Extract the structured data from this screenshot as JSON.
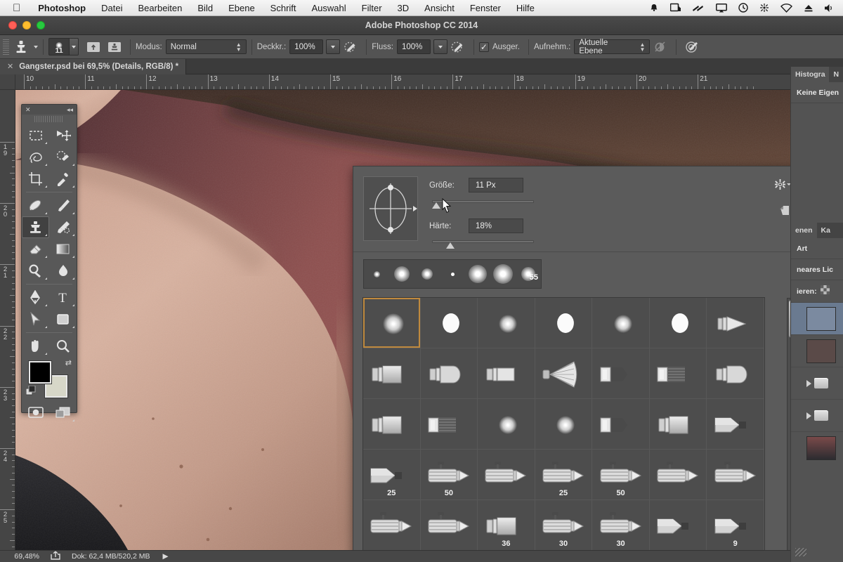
{
  "menubar": {
    "apple_icon": "apple-icon",
    "items": [
      {
        "label": "Photoshop",
        "bold": true
      },
      {
        "label": "Datei",
        "bold": false
      },
      {
        "label": "Bearbeiten",
        "bold": false
      },
      {
        "label": "Bild",
        "bold": false
      },
      {
        "label": "Ebene",
        "bold": false
      },
      {
        "label": "Schrift",
        "bold": false
      },
      {
        "label": "Auswahl",
        "bold": false
      },
      {
        "label": "Filter",
        "bold": false
      },
      {
        "label": "3D",
        "bold": false
      },
      {
        "label": "Ansicht",
        "bold": false
      },
      {
        "label": "Fenster",
        "bold": false
      },
      {
        "label": "Hilfe",
        "bold": false
      }
    ],
    "status_icons": [
      "bell-icon",
      "screen-share-icon",
      "fast-forward-icon",
      "airplay-icon",
      "time-machine-icon",
      "dropbox-icon",
      "wifi-icon",
      "eject-icon",
      "volume-icon"
    ]
  },
  "window": {
    "title": "Adobe Photoshop CC 2014",
    "close_label": "close-button",
    "minimize_label": "minimize-button",
    "zoom_label": "maximize-button"
  },
  "options_bar": {
    "tool_icon": "clone-stamp-icon",
    "brush_size": "11",
    "toggle_brush_panel_icon": "brush-panel-icon",
    "toggle_clone_source_icon": "clone-source-icon",
    "mode_label": "Modus:",
    "mode_value": "Normal",
    "opacity_label": "Deckkr.:",
    "opacity_value": "100%",
    "opacity_pressure_icon": "pressure-opacity-icon",
    "flow_label": "Fluss:",
    "flow_value": "100%",
    "airbrush_icon": "airbrush-icon",
    "aligned_label": "Ausger.",
    "aligned_checked": true,
    "sample_label": "Aufnehm.:",
    "sample_value": "Aktuelle Ebene",
    "ignore_adjustment_icon": "ignore-adjustment-layers-icon",
    "tablet_pressure_icon": "tablet-pressure-size-icon"
  },
  "document_tab": {
    "close_icon": "close-tab-icon",
    "title": "Gangster.psd bei 69,5% (Details, RGB/8) *"
  },
  "rulers": {
    "horizontal_labels": [
      "10",
      "11",
      "12",
      "13",
      "14",
      "15",
      "16",
      "17",
      "18",
      "19",
      "20",
      "21"
    ],
    "vertical_labels": [
      "19",
      "20",
      "21",
      "22",
      "23",
      "24",
      "25"
    ],
    "unit": "cm"
  },
  "toolbar": {
    "close_icon": "close-icon",
    "collapse_icon": "collapse-panel-icon",
    "tools": [
      {
        "name": "rectangular-marquee-tool",
        "sel": false,
        "tri": true
      },
      {
        "name": "move-tool",
        "sel": false,
        "tri": false
      },
      {
        "name": "lasso-tool",
        "sel": false,
        "tri": true
      },
      {
        "name": "quick-selection-tool",
        "sel": false,
        "tri": true
      },
      {
        "name": "crop-tool",
        "sel": false,
        "tri": true
      },
      {
        "name": "eyedropper-tool",
        "sel": false,
        "tri": true
      },
      {
        "name": "spot-healing-brush-tool",
        "sel": false,
        "tri": true
      },
      {
        "name": "brush-tool",
        "sel": false,
        "tri": true
      },
      {
        "name": "clone-stamp-tool",
        "sel": true,
        "tri": true
      },
      {
        "name": "history-brush-tool",
        "sel": false,
        "tri": true
      },
      {
        "name": "eraser-tool",
        "sel": false,
        "tri": true
      },
      {
        "name": "gradient-tool",
        "sel": false,
        "tri": true
      },
      {
        "name": "dodge-tool",
        "sel": false,
        "tri": true
      },
      {
        "name": "blur-tool",
        "sel": false,
        "tri": true
      },
      {
        "name": "pen-tool",
        "sel": false,
        "tri": true
      },
      {
        "name": "type-tool",
        "sel": false,
        "tri": true
      },
      {
        "name": "path-selection-tool",
        "sel": false,
        "tri": true
      },
      {
        "name": "rectangle-tool",
        "sel": false,
        "tri": true
      },
      {
        "name": "hand-tool",
        "sel": false,
        "tri": true
      },
      {
        "name": "zoom-tool",
        "sel": false,
        "tri": false
      }
    ],
    "foreground_color": "#000000",
    "background_color": "#d7d7c8",
    "swap_icon": "swap-colors-icon",
    "default_colors_icon": "default-colors-icon",
    "quick_mask_icon": "quick-mask-icon",
    "screen_mode_icon": "screen-mode-icon"
  },
  "brush_panel": {
    "size_label": "Größe:",
    "size_value": "11 Px",
    "size_slider_pct": 4,
    "hardness_label": "Härte:",
    "hardness_value": "18%",
    "hardness_slider_pct": 18,
    "gear_icon": "panel-options-gear-icon",
    "new_brush_icon": "new-brush-preset-icon",
    "tip_shape_icon": "brush-tip-angle-control",
    "recent_strip": [
      {
        "size": 9,
        "hard": false,
        "num": ""
      },
      {
        "size": 22,
        "hard": false,
        "num": ""
      },
      {
        "size": 16,
        "hard": false,
        "num": ""
      },
      {
        "size": 5,
        "hard": true,
        "num": ""
      },
      {
        "size": 26,
        "hard": false,
        "num": ""
      },
      {
        "size": 28,
        "hard": false,
        "num": ""
      },
      {
        "size": 20,
        "hard": false,
        "num": "55"
      }
    ],
    "presets": [
      {
        "icon": "soft-round-brush",
        "label": "",
        "selected": true
      },
      {
        "icon": "hard-round-brush",
        "label": "",
        "selected": false
      },
      {
        "icon": "soft-round-brush",
        "label": "",
        "selected": false
      },
      {
        "icon": "hard-round-brush",
        "label": "",
        "selected": false
      },
      {
        "icon": "soft-round-brush",
        "label": "",
        "selected": false
      },
      {
        "icon": "hard-round-brush",
        "label": "",
        "selected": false
      },
      {
        "icon": "round-point-bristle-brush",
        "label": "",
        "selected": false
      },
      {
        "icon": "flat-blunt-bristle-brush",
        "label": "",
        "selected": false
      },
      {
        "icon": "round-blunt-bristle-brush",
        "label": "",
        "selected": false
      },
      {
        "icon": "flat-curve-bristle-brush",
        "label": "",
        "selected": false
      },
      {
        "icon": "round-fan-bristle-brush",
        "label": "",
        "selected": false
      },
      {
        "icon": "flat-angle-bristle-brush",
        "label": "",
        "selected": false
      },
      {
        "icon": "flat-fan-bristle-brush",
        "label": "",
        "selected": false
      },
      {
        "icon": "round-blunt-bristle-brush",
        "label": "",
        "selected": false
      },
      {
        "icon": "flat-blunt-bristle-brush",
        "label": "",
        "selected": false
      },
      {
        "icon": "flat-fan-bristle-brush",
        "label": "",
        "selected": false
      },
      {
        "icon": "soft-round-brush",
        "label": "",
        "selected": false
      },
      {
        "icon": "soft-round-brush",
        "label": "",
        "selected": false
      },
      {
        "icon": "flat-angle-bristle-brush",
        "label": "",
        "selected": false
      },
      {
        "icon": "flat-blunt-bristle-brush",
        "label": "",
        "selected": false
      },
      {
        "icon": "pencil-brush",
        "label": "",
        "selected": false
      },
      {
        "icon": "pencil-brush",
        "label": "25",
        "selected": false
      },
      {
        "icon": "airbrush-soft-round",
        "label": "50",
        "selected": false
      },
      {
        "icon": "airbrush-soft-round",
        "label": "",
        "selected": false
      },
      {
        "icon": "airbrush-soft-round",
        "label": "25",
        "selected": false
      },
      {
        "icon": "airbrush-soft-round",
        "label": "50",
        "selected": false
      },
      {
        "icon": "airbrush-soft-round",
        "label": "",
        "selected": false
      },
      {
        "icon": "airbrush-soft-round",
        "label": "",
        "selected": false
      },
      {
        "icon": "airbrush-soft-round",
        "label": "",
        "selected": false
      },
      {
        "icon": "airbrush-soft-round",
        "label": "",
        "selected": false
      },
      {
        "icon": "flat-blunt-bristle-brush",
        "label": "36",
        "selected": false
      },
      {
        "icon": "airbrush-soft-round",
        "label": "30",
        "selected": false
      },
      {
        "icon": "airbrush-soft-round",
        "label": "30",
        "selected": false
      },
      {
        "icon": "pencil-brush",
        "label": "",
        "selected": false
      },
      {
        "icon": "pencil-brush",
        "label": "9",
        "selected": false
      }
    ]
  },
  "dock": {
    "tabs_top": [
      {
        "label": "Histogra",
        "active": true
      },
      {
        "label": "N",
        "active": false
      }
    ],
    "properties_text": "Keine Eigen",
    "tabs_layers": [
      {
        "label": "enen",
        "active": true
      },
      {
        "label": "Ka",
        "active": false
      }
    ],
    "filter_text": "Art",
    "blend_mode_text": "neares Lic",
    "lock_label": "ieren:",
    "lock_icon": "lock-transparent-pixels-icon",
    "layers": [
      {
        "type": "layer",
        "selected": true,
        "thumb": "#7b8aa0"
      },
      {
        "type": "layer",
        "selected": false,
        "thumb": "#5a4a48"
      },
      {
        "type": "group",
        "selected": false
      },
      {
        "type": "group",
        "selected": false
      },
      {
        "type": "photo",
        "selected": false
      }
    ],
    "resize_grip_icon": "resize-grip-icon"
  },
  "status_bar": {
    "zoom_level": "69,48%",
    "share_icon": "share-icon",
    "doc_info": "Dok: 62,4 MB/520,2 MB",
    "expand_icon": "expand-status-icon"
  },
  "colors": {
    "ps_chrome": "#535353",
    "panel_bg": "#5b5b5b",
    "selection_orange": "#c08a3e",
    "layer_selected": "#6a7a90"
  }
}
